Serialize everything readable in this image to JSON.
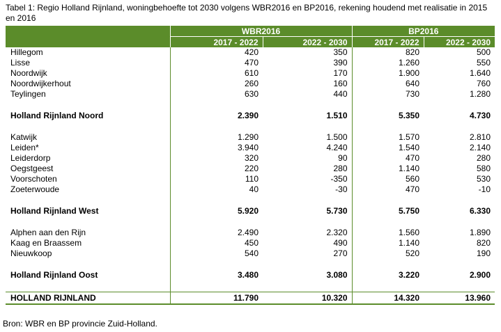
{
  "caption": "Tabel 1: Regio Holland Rijnland, woningbehoefte tot 2030 volgens WBR2016 en BP2016, rekening houdend met realisatie in 2015 en 2016",
  "header": {
    "groups": [
      "WBR2016",
      "BP2016"
    ],
    "periods": [
      "2017 - 2022",
      "2022 - 2030",
      "2017 - 2022",
      "2022 - 2030"
    ]
  },
  "sections": [
    {
      "rows": [
        {
          "name": "Hillegom",
          "values": [
            "420",
            "350",
            "820",
            "500"
          ]
        },
        {
          "name": "Lisse",
          "values": [
            "470",
            "390",
            "1.260",
            "550"
          ]
        },
        {
          "name": "Noordwijk",
          "values": [
            "610",
            "170",
            "1.900",
            "1.640"
          ]
        },
        {
          "name": "Noordwijkerhout",
          "values": [
            "260",
            "160",
            "640",
            "760"
          ]
        },
        {
          "name": "Teylingen",
          "values": [
            "630",
            "440",
            "730",
            "1.280"
          ]
        }
      ],
      "total": {
        "name": "Holland Rijnland Noord",
        "values": [
          "2.390",
          "1.510",
          "5.350",
          "4.730"
        ]
      }
    },
    {
      "rows": [
        {
          "name": "Katwijk",
          "values": [
            "1.290",
            "1.500",
            "1.570",
            "2.810"
          ]
        },
        {
          "name": "Leiden*",
          "values": [
            "3.940",
            "4.240",
            "1.540",
            "2.140"
          ]
        },
        {
          "name": "Leiderdorp",
          "values": [
            "320",
            "90",
            "470",
            "280"
          ]
        },
        {
          "name": "Oegstgeest",
          "values": [
            "220",
            "280",
            "1.140",
            "580"
          ]
        },
        {
          "name": "Voorschoten",
          "values": [
            "110",
            "-350",
            "560",
            "530"
          ]
        },
        {
          "name": "Zoeterwoude",
          "values": [
            "40",
            "-30",
            "470",
            "-10"
          ]
        }
      ],
      "total": {
        "name": "Holland Rijnland West",
        "values": [
          "5.920",
          "5.730",
          "5.750",
          "6.330"
        ]
      }
    },
    {
      "rows": [
        {
          "name": "Alphen aan den Rijn",
          "values": [
            "2.490",
            "2.320",
            "1.560",
            "1.890"
          ]
        },
        {
          "name": "Kaag en Braassem",
          "values": [
            "450",
            "490",
            "1.140",
            "820"
          ]
        },
        {
          "name": "Nieuwkoop",
          "values": [
            "540",
            "270",
            "520",
            "190"
          ]
        }
      ],
      "total": {
        "name": "Holland Rijnland Oost",
        "values": [
          "3.480",
          "3.080",
          "3.220",
          "2.900"
        ]
      }
    }
  ],
  "grand_total": {
    "name": "HOLLAND RIJNLAND",
    "values": [
      "11.790",
      "10.320",
      "14.320",
      "13.960"
    ]
  },
  "source": "Bron: WBR en BP provincie Zuid-Holland.",
  "colors": {
    "header_bg": "#5b8c2a",
    "header_text": "#ffffff"
  }
}
